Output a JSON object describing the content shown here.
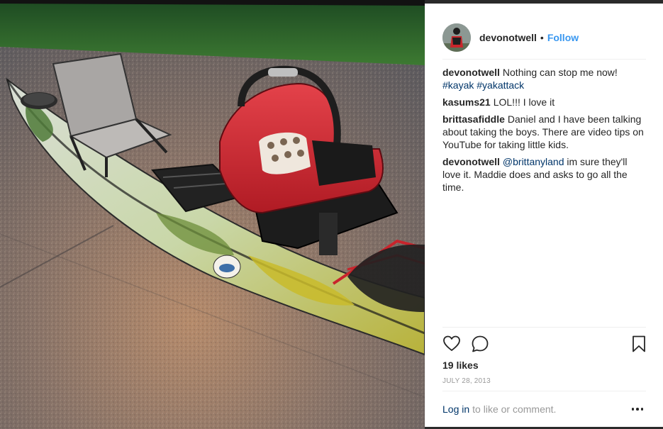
{
  "post": {
    "username": "devonotwell",
    "separator": "•",
    "follow_label": "Follow",
    "photo_alt": "Kayak with a seat and a red infant car seat strapped on",
    "comments": [
      {
        "author": "devonotwell",
        "text": "Nothing can stop me now!",
        "tags": [
          "#kayak",
          "#yakattack"
        ]
      },
      {
        "author": "kasums21",
        "text": "LOL!!! I love it"
      },
      {
        "author": "brittasafiddle",
        "text": "Daniel and I have been talking about taking the boys. There are video tips on YouTube for taking little kids."
      },
      {
        "author": "devonotwell",
        "mention": "@brittanyland",
        "text": "im sure they'll love it. Maddie does and asks to go all the time."
      }
    ],
    "likes": "19 likes",
    "date": "JULY 28, 2013",
    "login_link": "Log in",
    "login_suffix": "to like or comment.",
    "icons": {
      "like": "heart-icon",
      "comment": "comment-icon",
      "save": "bookmark-icon",
      "more": "more-options-icon"
    },
    "colors": {
      "link": "#003569",
      "follow": "#3897f0",
      "muted": "#999999",
      "text": "#262626"
    }
  }
}
